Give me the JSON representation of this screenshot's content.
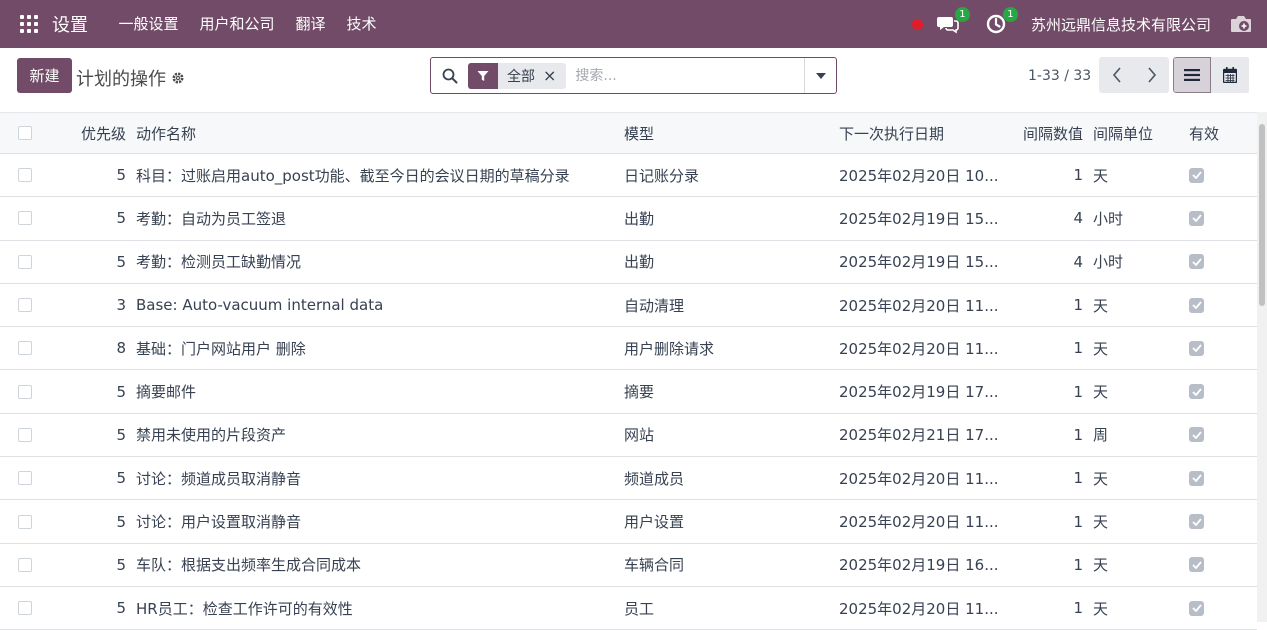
{
  "navbar": {
    "brand": "设置",
    "menu": [
      "一般设置",
      "用户和公司",
      "翻译",
      "技术"
    ],
    "messages_badge": "1",
    "activities_badge": "1",
    "company": "苏州远鼎信息技术有限公司"
  },
  "control": {
    "new_label": "新建",
    "title": "计划的操作",
    "facet_label": "全部",
    "facet_close": "×",
    "search_placeholder": "搜索...",
    "pager": "1-33 / 33"
  },
  "columns": {
    "priority": "优先级",
    "name": "动作名称",
    "model": "模型",
    "next_date": "下一次执行日期",
    "interval_number": "间隔数值",
    "interval_unit": "间隔单位",
    "active": "有效"
  },
  "rows": [
    {
      "priority": "5",
      "name": "科目：过账启用auto_post功能、截至今日的会议日期的草稿分录",
      "model": "日记账分录",
      "next_date": "2025年02月20日 10...",
      "interval": "1",
      "unit": "天"
    },
    {
      "priority": "5",
      "name": "考勤：自动为员工签退",
      "model": "出勤",
      "next_date": "2025年02月19日 15...",
      "interval": "4",
      "unit": "小时"
    },
    {
      "priority": "5",
      "name": "考勤：检测员工缺勤情况",
      "model": "出勤",
      "next_date": "2025年02月19日 15...",
      "interval": "4",
      "unit": "小时"
    },
    {
      "priority": "3",
      "name": "Base: Auto-vacuum internal data",
      "model": "自动清理",
      "next_date": "2025年02月20日 11...",
      "interval": "1",
      "unit": "天"
    },
    {
      "priority": "8",
      "name": "基础：门户网站用户 删除",
      "model": "用户删除请求",
      "next_date": "2025年02月20日 11...",
      "interval": "1",
      "unit": "天"
    },
    {
      "priority": "5",
      "name": "摘要邮件",
      "model": "摘要",
      "next_date": "2025年02月19日 17...",
      "interval": "1",
      "unit": "天"
    },
    {
      "priority": "5",
      "name": "禁用未使用的片段资产",
      "model": "网站",
      "next_date": "2025年02月21日 17...",
      "interval": "1",
      "unit": "周"
    },
    {
      "priority": "5",
      "name": "讨论：频道成员取消静音",
      "model": "频道成员",
      "next_date": "2025年02月20日 11...",
      "interval": "1",
      "unit": "天"
    },
    {
      "priority": "5",
      "name": "讨论：用户设置取消静音",
      "model": "用户设置",
      "next_date": "2025年02月20日 11...",
      "interval": "1",
      "unit": "天"
    },
    {
      "priority": "5",
      "name": "车队：根据支出频率生成合同成本",
      "model": "车辆合同",
      "next_date": "2025年02月19日 16...",
      "interval": "1",
      "unit": "天"
    },
    {
      "priority": "5",
      "name": "HR员工：检查工作许可的有效性",
      "model": "员工",
      "next_date": "2025年02月20日 11...",
      "interval": "1",
      "unit": "天"
    }
  ]
}
